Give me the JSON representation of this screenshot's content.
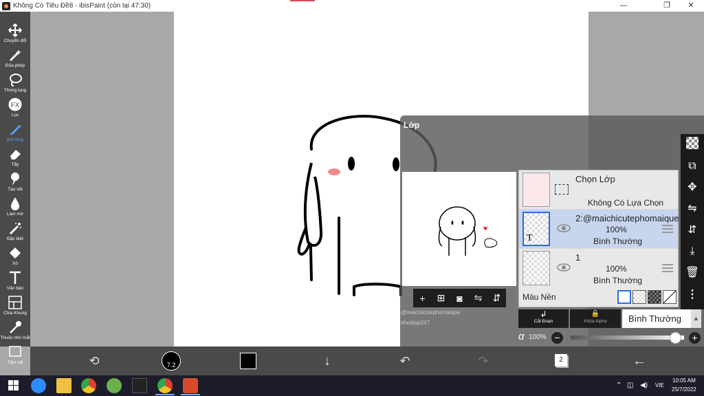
{
  "window": {
    "title": "Không Có Tiêu Đề8 - ibisPaint (còn lại 47:30)",
    "minimize": "—",
    "restore": "❐",
    "close": "✕"
  },
  "tools": [
    {
      "label": "Chuyển đổi",
      "icon": "move-icon"
    },
    {
      "label": "Đũa phép",
      "icon": "magic-wand-icon"
    },
    {
      "label": "Thòng lọng",
      "icon": "lasso-icon"
    },
    {
      "label": "Lọc",
      "icon": "fx-icon"
    },
    {
      "label": "Bút lông",
      "icon": "brush-icon",
      "active": true
    },
    {
      "label": "Tẩy",
      "icon": "eraser-icon"
    },
    {
      "label": "Tạo vết",
      "icon": "smudge-icon"
    },
    {
      "label": "Làm mờ",
      "icon": "blur-icon"
    },
    {
      "label": "Đặc biệt",
      "icon": "special-icon"
    },
    {
      "label": "Xô",
      "icon": "bucket-icon"
    },
    {
      "label": "Văn bản",
      "icon": "text-icon"
    },
    {
      "label": "Chia Khung",
      "icon": "frame-divider-icon"
    },
    {
      "label": "Thuốc nhỏ mắt",
      "icon": "eyedropper-icon"
    },
    {
      "label": "Tấm vải",
      "icon": "canvas-icon"
    }
  ],
  "panel": {
    "title": "Lớp",
    "watermark1": "@maichicutephomaique",
    "watermark2": "#hoidap247",
    "fx_text": "FX",
    "text_glyph": "T",
    "layers": [
      {
        "name": "Chọn Lớp",
        "sub": "Không Có Lựa Chọn"
      },
      {
        "name": "2:@maichicutephomaique",
        "opacity": "100%",
        "mode": "Bình Thường",
        "selected": true
      },
      {
        "name": "1",
        "opacity": "100%",
        "mode": "Bình Thường"
      }
    ],
    "background_label": "Màu Nền",
    "clip_label": "Cắt Đoạn",
    "alpha_lock_label": "Khóa Alpha",
    "blend_mode": "Bình Thường",
    "alpha_symbol": "α",
    "alpha_value": "100%",
    "alpha_fraction": 0.92,
    "minus": "−",
    "plus": "+"
  },
  "bottom": {
    "brush_size": "7.2",
    "layer_count": "2",
    "brush_color": "#000000"
  },
  "taskbar": {
    "language": "VIE",
    "time": "10:05 AM",
    "date": "25/7/2022"
  },
  "colors": {
    "accent": "#2a6bd9",
    "panel_bg": "#5a5a5a",
    "toolbar": "#4a4a4a",
    "active_tool": "#5aa0ff"
  }
}
